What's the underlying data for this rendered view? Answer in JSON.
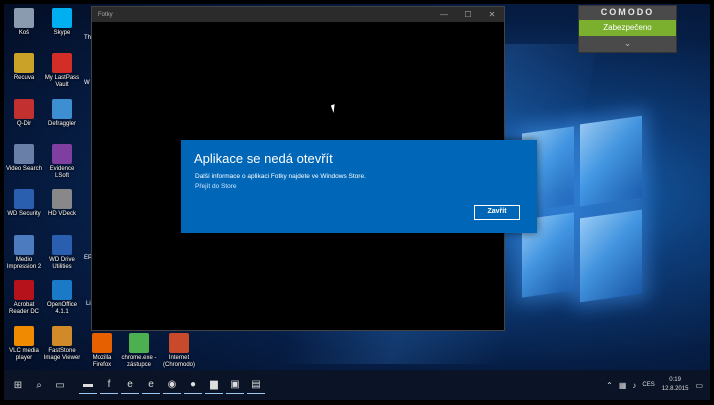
{
  "comodo": {
    "brand": "COMODO",
    "status": "Zabezpečeno",
    "status_color": "#7ab02e"
  },
  "app_window": {
    "title": "Fotky",
    "controls": [
      "—",
      "☐",
      "✕"
    ]
  },
  "dialog": {
    "heading": "Aplikace se nedá otevřít",
    "message": "Další informace o aplikaci Fotky najdete ve Windows Store.",
    "link": "Přejít do Store",
    "button": "Zavřít",
    "accent": "#0067b8"
  },
  "desktop_icons": [
    {
      "label": "Koš",
      "icon": "recycle-bin-icon",
      "color": "#8a9bb0"
    },
    {
      "label": "Skype",
      "icon": "skype-icon",
      "color": "#00aff0"
    },
    {
      "label": "Recuva",
      "icon": "recuva-icon",
      "color": "#c9a227"
    },
    {
      "label": "My LastPass\nVault",
      "icon": "lastpass-icon",
      "color": "#d32d27"
    },
    {
      "label": "Q-Dir",
      "icon": "q-dir-icon",
      "color": "#c23030"
    },
    {
      "label": "Defraggler",
      "icon": "defraggler-icon",
      "color": "#3d8fd1"
    },
    {
      "label": "Video Search",
      "icon": "video-search-icon",
      "color": "#6a7fa8"
    },
    {
      "label": "Evidence\nLSoft",
      "icon": "evidence-icon",
      "color": "#7e3fa0"
    },
    {
      "label": "WD Security",
      "icon": "wd-security-icon",
      "color": "#2a5fb0"
    },
    {
      "label": "HD VDeck",
      "icon": "hd-vdeck-icon",
      "color": "#888888"
    },
    {
      "label": "Medio\nImpression 2",
      "icon": "medio-icon",
      "color": "#4c7bc0"
    },
    {
      "label": "WD Drive\nUtilities",
      "icon": "wd-drive-icon",
      "color": "#2a5fb0"
    },
    {
      "label": "Acrobat\nReader DC",
      "icon": "acrobat-icon",
      "color": "#b5121b"
    },
    {
      "label": "OpenOffice\n4.1.1",
      "icon": "openoffice-icon",
      "color": "#1a7ac8"
    },
    {
      "label": "VLC media\nplayer",
      "icon": "vlc-icon",
      "color": "#f08a00"
    },
    {
      "label": "FastStone\nImage Viewer",
      "icon": "faststone-icon",
      "color": "#d08a2a"
    },
    {
      "label": "Mozilla\nFirefox",
      "icon": "firefox-icon",
      "color": "#e66000"
    },
    {
      "label": "chrome.exe -\nzástupce",
      "icon": "chrome-icon",
      "color": "#4caf50"
    },
    {
      "label": "Internet\n(Chromodo)",
      "icon": "chromodo-icon",
      "color": "#c94a2a"
    }
  ],
  "partial_labels": [
    "Th",
    "W",
    "EP",
    "Li"
  ],
  "taskbar": {
    "items": [
      {
        "icon": "start-icon",
        "glyph": "⊞"
      },
      {
        "icon": "search-icon",
        "glyph": "⌕"
      },
      {
        "icon": "task-view-icon",
        "glyph": "▭"
      },
      {
        "icon": "keyboard-icon",
        "glyph": "▬"
      },
      {
        "icon": "facebook-icon",
        "glyph": "f"
      },
      {
        "icon": "edge-icon",
        "glyph": "e"
      },
      {
        "icon": "ie-icon",
        "glyph": "e"
      },
      {
        "icon": "chromodo-task-icon",
        "glyph": "◉"
      },
      {
        "icon": "record-icon",
        "glyph": "●"
      },
      {
        "icon": "explorer-icon",
        "glyph": "▆"
      },
      {
        "icon": "store-icon",
        "glyph": "▣"
      },
      {
        "icon": "photos-task-icon",
        "glyph": "▤"
      }
    ],
    "tray": {
      "language": "CES",
      "time": "0:19",
      "date": "12.8.2015"
    }
  }
}
